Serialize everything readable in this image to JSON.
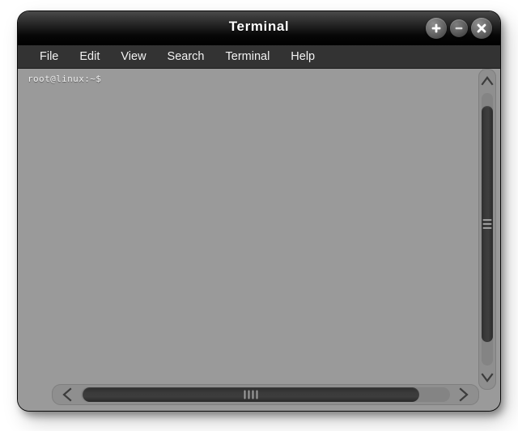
{
  "window": {
    "title": "Terminal",
    "buttons": [
      {
        "name": "maximize-button",
        "icon": "plus-icon",
        "label": "+"
      },
      {
        "name": "minimize-button",
        "icon": "minus-icon",
        "label": "–"
      },
      {
        "name": "close-button",
        "icon": "close-icon",
        "label": "×"
      }
    ]
  },
  "menubar": {
    "items": [
      {
        "label": "File"
      },
      {
        "label": "Edit"
      },
      {
        "label": "View"
      },
      {
        "label": "Search"
      },
      {
        "label": "Terminal"
      },
      {
        "label": "Help"
      }
    ]
  },
  "terminal": {
    "prompt": "root@linux:~$",
    "background_color": "#9a9a9a",
    "text_color": "#f0f0f0",
    "lines": [
      "root@linux:~$"
    ]
  },
  "scrollbars": {
    "vertical": {
      "up_arrow_icon": "chevron-up-icon",
      "down_arrow_icon": "chevron-down-icon",
      "grip_lines": 3
    },
    "horizontal": {
      "left_arrow_icon": "chevron-left-icon",
      "right_arrow_icon": "chevron-right-icon",
      "grip_lines": 4
    }
  },
  "colors": {
    "titlebar": "#000000",
    "menubar": "#333333",
    "frame": "#9a9a9a",
    "scroll_thumb": "#3a3a3a",
    "scroll_trough": "#848484"
  }
}
